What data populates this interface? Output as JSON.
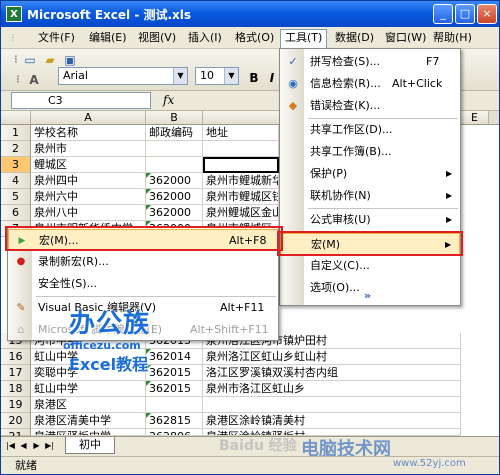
{
  "window": {
    "title": "Microsoft Excel - 测试.xls",
    "icon": "excel-icon"
  },
  "window_buttons": [
    "_",
    "□",
    "×"
  ],
  "menubar": [
    "文件(F)",
    "编辑(E)",
    "视图(V)",
    "插入(I)",
    "格式(O)",
    "工具(T)",
    "数据(D)",
    "窗口(W)",
    "帮助(H)"
  ],
  "active_menu": "工具(T)",
  "toolbar": {
    "font_name": "Arial",
    "font_size": "10",
    "bold": "B",
    "italic": "I",
    "underline": "U"
  },
  "formula": {
    "cell_ref": "C3",
    "fx": "fx"
  },
  "columns": [
    "A",
    "B",
    "C",
    "E"
  ],
  "rows": [
    {
      "n": "1",
      "a": "学校名称",
      "b": "邮政编码",
      "c": "地址"
    },
    {
      "n": "2",
      "a": "泉州市",
      "b": "",
      "c": ""
    },
    {
      "n": "3",
      "a": "鲤城区",
      "b": "",
      "c": ""
    },
    {
      "n": "4",
      "a": "泉州四中",
      "b": "362000",
      "c": "泉州市鲤城新华"
    },
    {
      "n": "5",
      "a": "泉州六中",
      "b": "362000",
      "c": "泉州市鲤城区钱"
    },
    {
      "n": "6",
      "a": "泉州八中",
      "b": "362000",
      "c": "泉州鲤城区金山"
    },
    {
      "n": "7",
      "a": "泉州市明新华侨中学",
      "b": "362000",
      "c": "泉州市鲤城区"
    },
    {
      "n": "15",
      "a": "河市中学",
      "b": "362013",
      "c": "泉州洛江区河市镇炉田村"
    },
    {
      "n": "16",
      "a": "虹山中学",
      "b": "362014",
      "c": "泉州洛江区虹山乡虹山村"
    },
    {
      "n": "17",
      "a": "奕聪中学",
      "b": "362015",
      "c": "洛江区罗溪镇双溪村杏内组"
    },
    {
      "n": "18",
      "a": "虹山中学",
      "b": "362015",
      "c": "泉州市洛江区虹山乡"
    },
    {
      "n": "19",
      "a": "泉港区",
      "b": "",
      "c": ""
    },
    {
      "n": "20",
      "a": "泉港区清美中学",
      "b": "362815",
      "c": "泉港区涂岭镇清美村"
    },
    {
      "n": "21",
      "a": "泉港区驿坂中学",
      "b": "362806",
      "c": "泉港区涂岭镇驿坂村"
    }
  ],
  "tools_menu": [
    {
      "label": "拼写检查(S)...",
      "shortcut": "F7",
      "icon": "spellcheck-icon"
    },
    {
      "label": "信息检索(R)...",
      "shortcut": "Alt+Click",
      "icon": "research-icon"
    },
    {
      "label": "错误检查(K)...",
      "shortcut": "",
      "icon": "error-check-icon"
    },
    {
      "label": "共享工作区(D)...",
      "shortcut": ""
    },
    {
      "label": "共享工作簿(B)...",
      "shortcut": ""
    },
    {
      "label": "保护(P)",
      "shortcut": "",
      "submenu": true
    },
    {
      "label": "联机协作(N)",
      "shortcut": "",
      "submenu": true
    },
    {
      "label": "公式审核(U)",
      "shortcut": "",
      "submenu": true
    },
    {
      "label": "宏(M)",
      "shortcut": "",
      "submenu": true,
      "highlighted": true
    },
    {
      "label": "自定义(C)...",
      "shortcut": ""
    },
    {
      "label": "选项(O)...",
      "shortcut": ""
    },
    {
      "label": "»",
      "shortcut": "",
      "icon": "expand-chevron-icon"
    }
  ],
  "macro_menu": [
    {
      "label": "宏(M)...",
      "shortcut": "Alt+F8",
      "icon": "run-macro-icon",
      "highlighted": true
    },
    {
      "label": "录制新宏(R)...",
      "shortcut": "",
      "icon": "record-icon"
    },
    {
      "label": "安全性(S)...",
      "shortcut": ""
    },
    {
      "label": "Visual Basic 编辑器(V)",
      "shortcut": "Alt+F11",
      "icon": "vb-editor-icon"
    },
    {
      "label": "Microsoft 脚本编辑器(E)",
      "shortcut": "Alt+Shift+F11",
      "disabled": true,
      "icon": "script-editor-icon"
    }
  ],
  "sheet_tab": "初中",
  "status": "就绪",
  "watermarks": {
    "brand": "办公族",
    "site": "officezu.com",
    "sub": "Excel教程",
    "baidu": "Baidu 经验",
    "right": "电脑技术网",
    "right_url": "www.52yj.com"
  },
  "colors": {
    "title": "#0a5ae0",
    "highlight": "#ffeec2",
    "red_box": "#e02020"
  }
}
